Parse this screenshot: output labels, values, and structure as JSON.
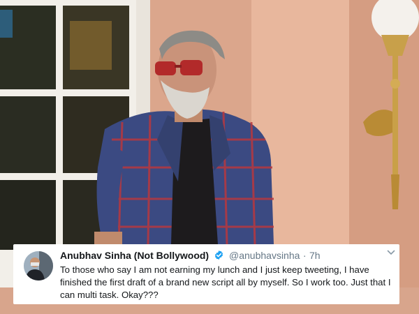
{
  "tweet": {
    "display_name": "Anubhav Sinha (Not Bollywood)",
    "handle": "@anubhavsinha",
    "separator": "·",
    "time": "7h",
    "text": "To those who say I am not earning my lunch and I just keep tweeting, I have finished the first draft of a brand new script all by myself. So I work too. Just that I can multi task. Okay???"
  },
  "icons": {
    "verified": "verified-badge-icon",
    "chevron": "chevron-down-icon"
  },
  "colors": {
    "verified_blue": "#1da1f2",
    "name_text": "#14171a",
    "secondary_text": "#657786"
  }
}
